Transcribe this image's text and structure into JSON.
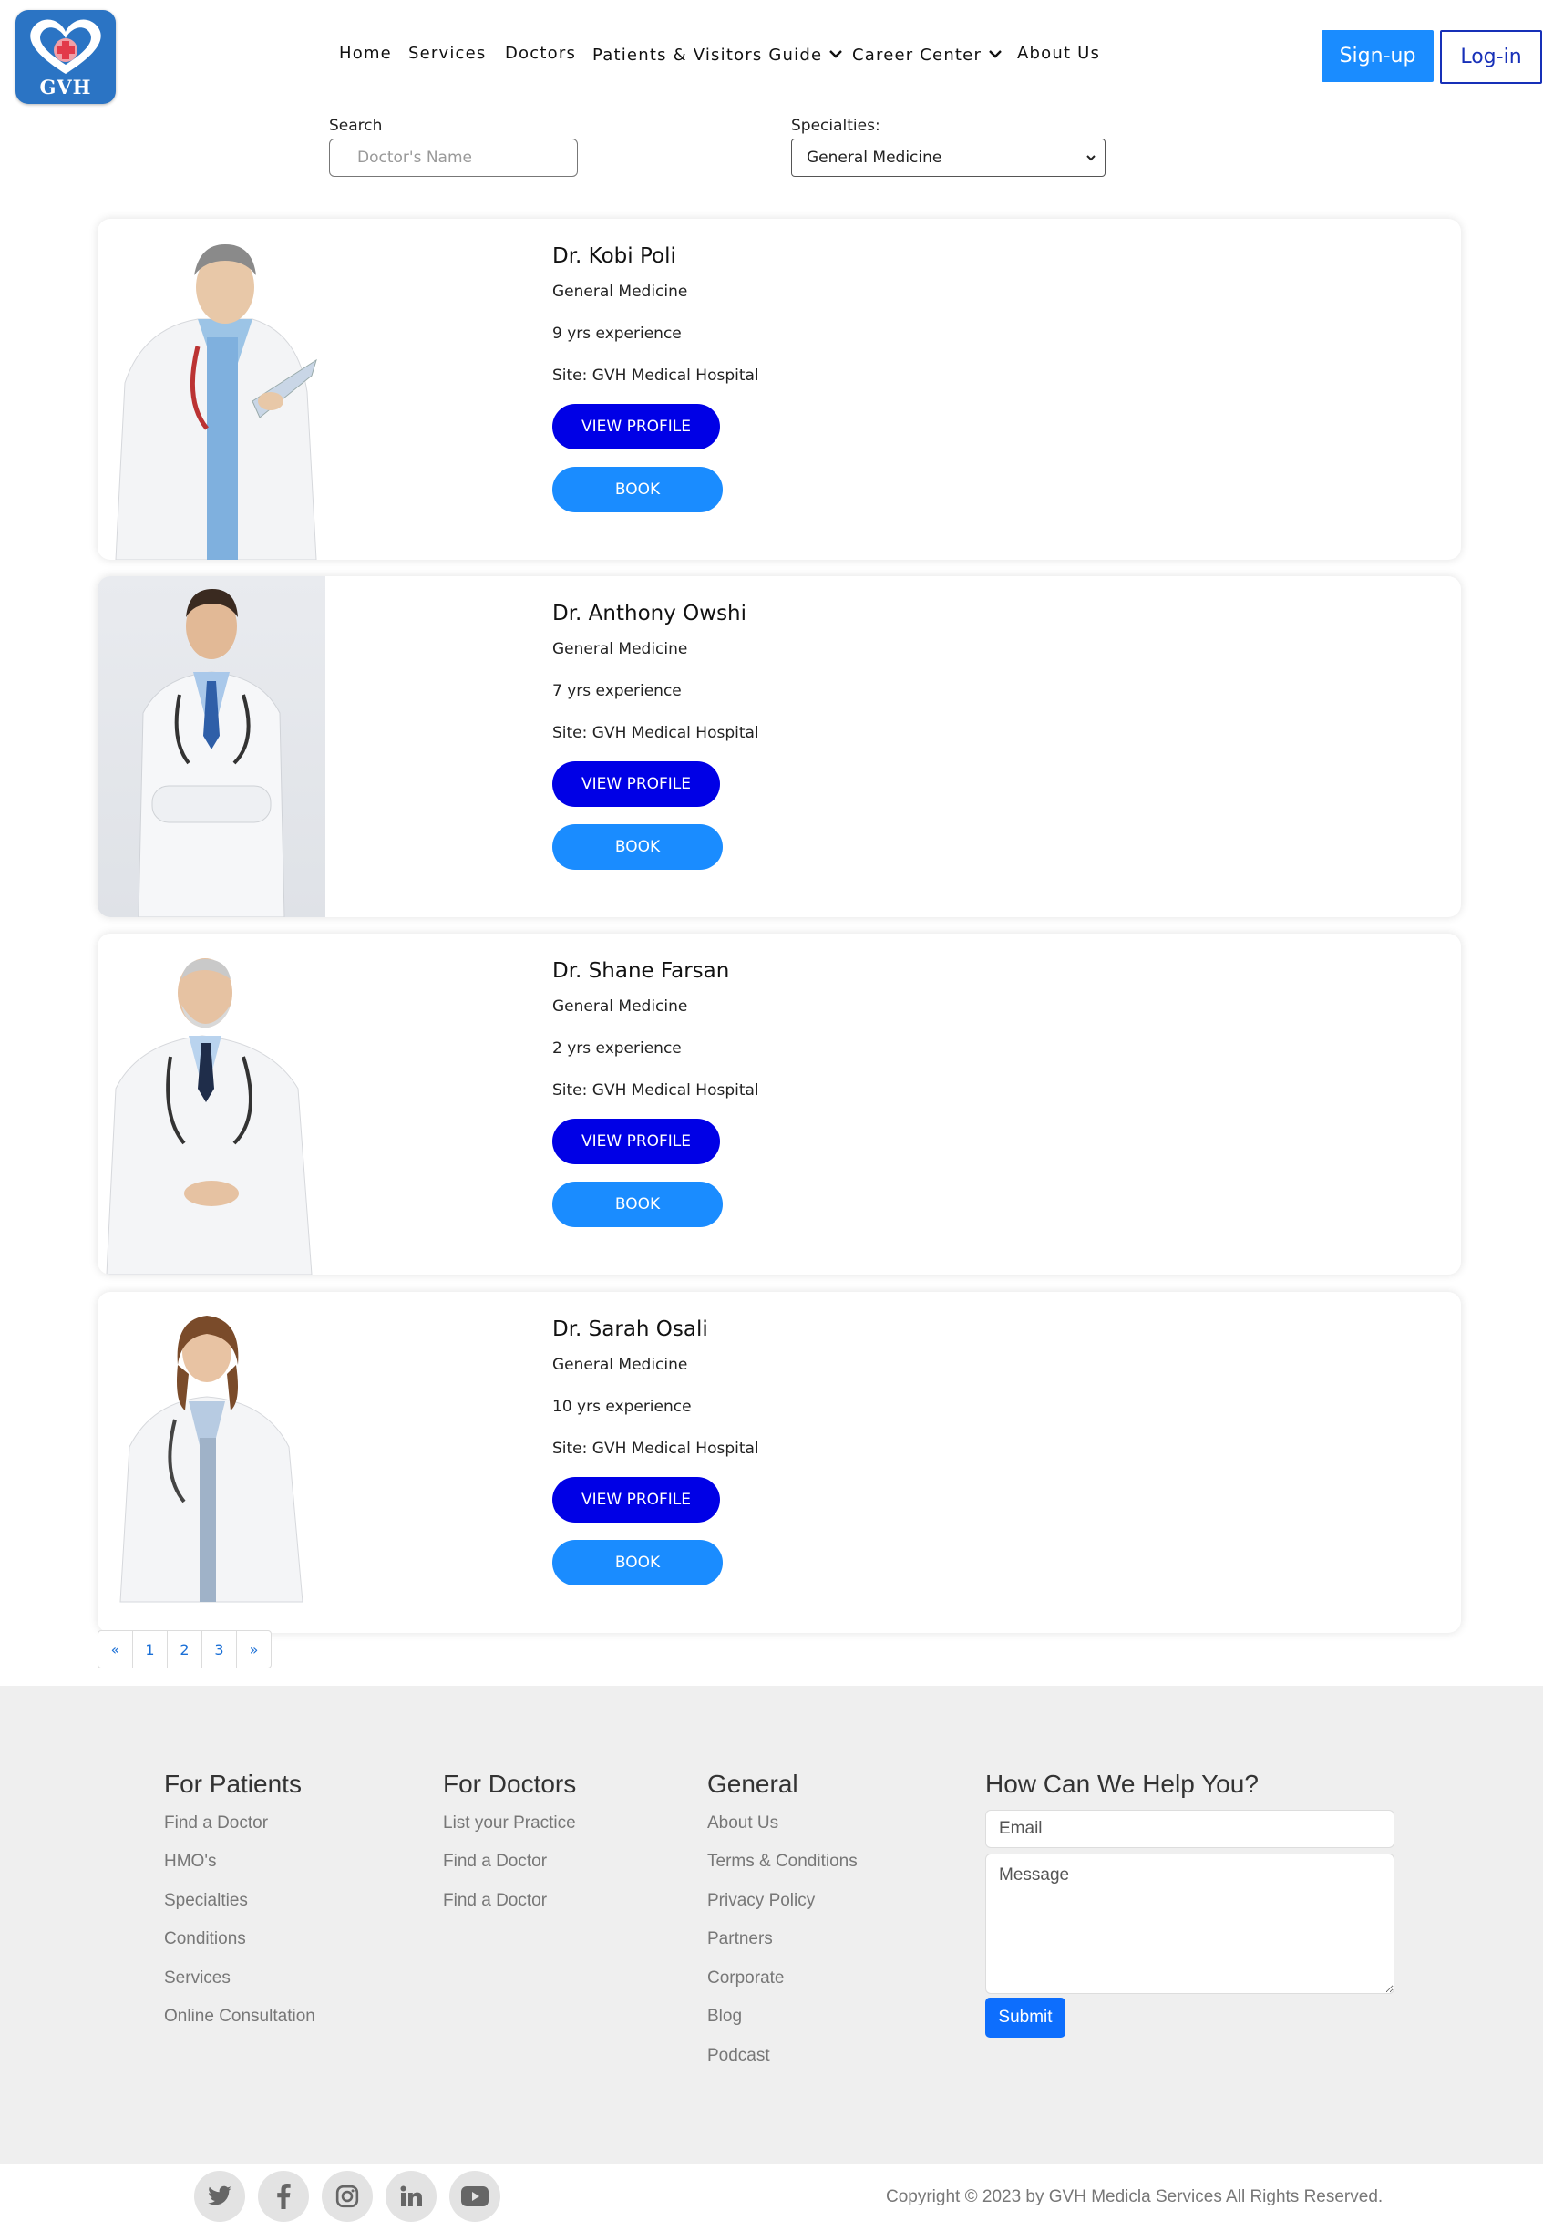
{
  "brand": {
    "logo_text": "GVH",
    "primary": "#1a8cff",
    "dark_blue": "#0000e6"
  },
  "nav": {
    "items": [
      {
        "label": "Home"
      },
      {
        "label": "Services"
      },
      {
        "label": "Doctors"
      },
      {
        "label": "Patients & Visitors Guide",
        "has_dropdown": true
      },
      {
        "label": "Career Center",
        "has_dropdown": true
      },
      {
        "label": "About Us"
      }
    ],
    "signup_label": "Sign-up",
    "login_label": "Log-in"
  },
  "filters": {
    "search_label": "Search",
    "search_placeholder": "Doctor's Name",
    "specialties_label": "Specialties:",
    "specialty_selected": "General Medicine"
  },
  "doctors": [
    {
      "name": "Dr. Kobi Poli",
      "specialty": "General Medicine",
      "experience": "9 yrs experience",
      "site": "Site: GVH Medical Hospital",
      "view_label": "VIEW PROFILE",
      "book_label": "BOOK"
    },
    {
      "name": "Dr. Anthony Owshi",
      "specialty": "General Medicine",
      "experience": "7 yrs experience",
      "site": "Site: GVH Medical Hospital",
      "view_label": "VIEW PROFILE",
      "book_label": "BOOK"
    },
    {
      "name": "Dr. Shane Farsan",
      "specialty": "General Medicine",
      "experience": "2 yrs experience",
      "site": "Site: GVH Medical Hospital",
      "view_label": "VIEW PROFILE",
      "book_label": "BOOK"
    },
    {
      "name": "Dr. Sarah Osali",
      "specialty": "General Medicine",
      "experience": "10 yrs experience",
      "site": "Site: GVH Medical Hospital",
      "view_label": "VIEW PROFILE",
      "book_label": "BOOK"
    }
  ],
  "pagination": {
    "prev": "«",
    "pages": [
      "1",
      "2",
      "3"
    ],
    "next": "»"
  },
  "footer": {
    "patients": {
      "title": "For Patients",
      "links": [
        "Find a Doctor",
        "HMO's",
        "Specialties",
        "Conditions",
        "Services",
        "Online Consultation"
      ]
    },
    "doctors": {
      "title": "For Doctors",
      "links": [
        "List your Practice",
        "Find a Doctor",
        "Find a Doctor"
      ]
    },
    "general": {
      "title": "General",
      "links": [
        "About Us",
        "Terms & Conditions",
        "Privacy Policy",
        "Partners",
        "Corporate",
        "Blog",
        "Podcast"
      ]
    },
    "contact": {
      "title": "How Can We Help You?",
      "email_placeholder": "Email",
      "message_placeholder": "Message",
      "submit_label": "Submit"
    },
    "social_icons": [
      "twitter-icon",
      "facebook-icon",
      "instagram-icon",
      "linkedin-icon",
      "youtube-icon"
    ],
    "copyright": "Copyright © 2023 by GVH Medicla Services All Rights Reserved."
  }
}
